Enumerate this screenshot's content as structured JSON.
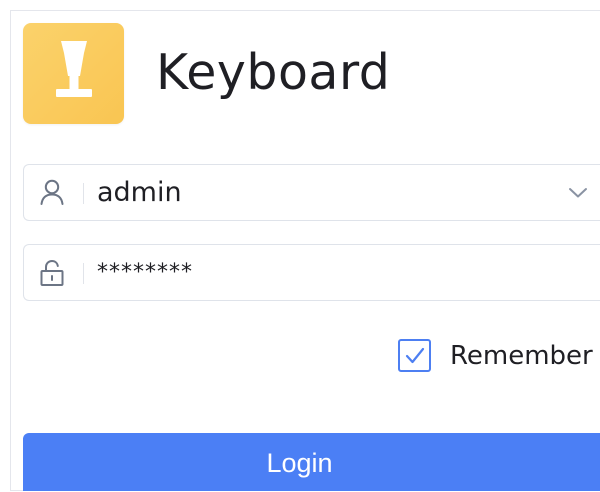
{
  "app": {
    "title": "Keyboard",
    "logo_icon": "keyboard-key-icon",
    "logo_color": "#f9c552"
  },
  "form": {
    "username": {
      "icon": "user-icon",
      "value": "admin",
      "dropdown_icon": "chevron-down-icon"
    },
    "password": {
      "icon": "unlock-icon",
      "value": "********"
    },
    "remember": {
      "label": "Remember",
      "checked": true,
      "accent": "#4d7ff2"
    },
    "login_button": {
      "label": "Login",
      "color": "#4b7ff5"
    }
  }
}
